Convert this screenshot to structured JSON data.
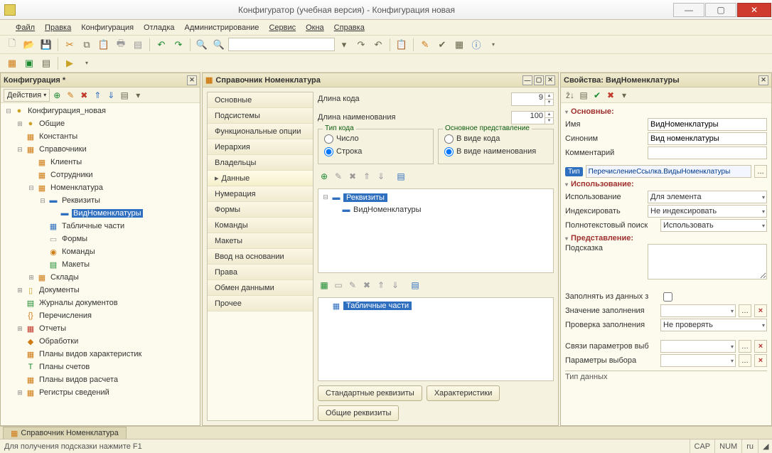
{
  "window": {
    "title": "Конфигуратор (учебная версия) - Конфигурация новая"
  },
  "menu": [
    "Файл",
    "Правка",
    "Конфигурация",
    "Отладка",
    "Администрирование",
    "Сервис",
    "Окна",
    "Справка"
  ],
  "left_panel": {
    "title": "Конфигурация *",
    "actions_label": "Действия",
    "tree": {
      "root": "Конфигурация_новая",
      "nodes": [
        {
          "label": "Общие",
          "expandable": true,
          "depth": 1,
          "icon": "●",
          "cls": "ico-yellow"
        },
        {
          "label": "Константы",
          "expandable": false,
          "depth": 1,
          "icon": "▦",
          "cls": "ico-orange"
        },
        {
          "label": "Справочники",
          "expandable": true,
          "expanded": true,
          "depth": 1,
          "icon": "▦",
          "cls": "ico-orange"
        },
        {
          "label": "Клиенты",
          "depth": 2,
          "icon": "▦",
          "cls": "ico-orange"
        },
        {
          "label": "Сотрудники",
          "depth": 2,
          "icon": "▦",
          "cls": "ico-orange"
        },
        {
          "label": "Номенклатура",
          "expandable": true,
          "expanded": true,
          "depth": 2,
          "icon": "▦",
          "cls": "ico-orange"
        },
        {
          "label": "Реквизиты",
          "expandable": true,
          "expanded": true,
          "depth": 3,
          "icon": "▬",
          "cls": "ico-blue"
        },
        {
          "label": "ВидНоменклатуры",
          "depth": 4,
          "icon": "▬",
          "cls": "ico-blue",
          "selected": true
        },
        {
          "label": "Табличные части",
          "depth": 3,
          "icon": "▦",
          "cls": "ico-blue"
        },
        {
          "label": "Формы",
          "depth": 3,
          "icon": "▭",
          "cls": "ico-grey"
        },
        {
          "label": "Команды",
          "depth": 3,
          "icon": "◉",
          "cls": "ico-orange"
        },
        {
          "label": "Макеты",
          "depth": 3,
          "icon": "▤",
          "cls": "ico-green"
        },
        {
          "label": "Склады",
          "expandable": true,
          "depth": 2,
          "icon": "▦",
          "cls": "ico-orange"
        },
        {
          "label": "Документы",
          "expandable": true,
          "depth": 1,
          "icon": "▯",
          "cls": "ico-yellow"
        },
        {
          "label": "Журналы документов",
          "depth": 1,
          "icon": "▤",
          "cls": "ico-green"
        },
        {
          "label": "Перечисления",
          "depth": 1,
          "icon": "{}",
          "cls": "ico-orange"
        },
        {
          "label": "Отчеты",
          "expandable": true,
          "depth": 1,
          "icon": "▦",
          "cls": "ico-red"
        },
        {
          "label": "Обработки",
          "depth": 1,
          "icon": "◆",
          "cls": "ico-orange"
        },
        {
          "label": "Планы видов характеристик",
          "depth": 1,
          "icon": "▦",
          "cls": "ico-orange"
        },
        {
          "label": "Планы счетов",
          "depth": 1,
          "icon": "T",
          "cls": "ico-green"
        },
        {
          "label": "Планы видов расчета",
          "depth": 1,
          "icon": "▦",
          "cls": "ico-orange"
        },
        {
          "label": "Регистры сведений",
          "expandable": true,
          "depth": 1,
          "icon": "▦",
          "cls": "ico-orange"
        }
      ]
    }
  },
  "mid_panel": {
    "title": "Справочник Номенклатура",
    "categories": [
      "Основные",
      "Подсистемы",
      "Функциональные опции",
      "Иерархия",
      "Владельцы",
      "Данные",
      "Нумерация",
      "Формы",
      "Команды",
      "Макеты",
      "Ввод на основании",
      "Права",
      "Обмен данными",
      "Прочее"
    ],
    "active_category": 5,
    "code_length_label": "Длина кода",
    "code_length_value": "9",
    "name_length_label": "Длина наименования",
    "name_length_value": "100",
    "code_type_title": "Тип кода",
    "code_type_options": [
      "Число",
      "Строка"
    ],
    "code_type_selected": 1,
    "main_view_title": "Основное представление",
    "main_view_options": [
      "В виде кода",
      "В виде наименования"
    ],
    "main_view_selected": 1,
    "req_tree_root": "Реквизиты",
    "req_tree_child": "ВидНоменклатуры",
    "tab_parts_root": "Табличные части",
    "btn_std_req": "Стандартные реквизиты",
    "btn_charact": "Характеристики",
    "btn_common_req": "Общие реквизиты"
  },
  "props_panel": {
    "title": "Свойства: ВидНоменклатуры",
    "sections": {
      "basic": "Основные:",
      "usage": "Использование:",
      "view": "Представление:"
    },
    "rows": {
      "name_label": "Имя",
      "name_value": "ВидНоменклатуры",
      "synonym_label": "Синоним",
      "synonym_value": "Вид номенклатуры",
      "comment_label": "Комментарий",
      "comment_value": "",
      "type_label": "Тип",
      "type_value": "ПеречислениеСсылка.ВидыНоменклатуры",
      "usage_label": "Использование",
      "usage_value": "Для элемента",
      "index_label": "Индексировать",
      "index_value": "Не индексировать",
      "fulltext_label": "Полнотекстовый поиск",
      "fulltext_value": "Использовать",
      "hint_label": "Подсказка",
      "fillfrom_label": "Заполнять из данных з",
      "fillvalue_label": "Значение заполнения",
      "fillcheck_label": "Проверка заполнения",
      "fillcheck_value": "Не проверять",
      "linkparams_label": "Связи параметров выб",
      "selparams_label": "Параметры выбора",
      "datatype_label": "Тип данных"
    }
  },
  "doc_tab": "Справочник Номенклатура",
  "status": {
    "hint": "Для получения подсказки нажмите F1",
    "cap": "CAP",
    "num": "NUM",
    "lang": "ru"
  }
}
